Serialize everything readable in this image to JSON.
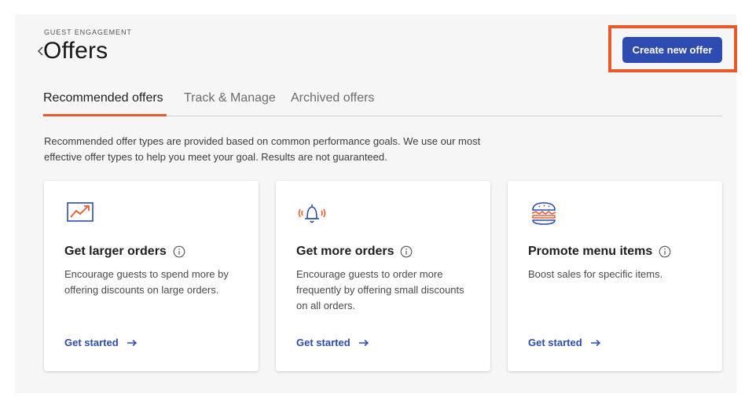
{
  "header": {
    "eyebrow": "GUEST ENGAGEMENT",
    "title": "Offers",
    "cta_label": "Create new offer"
  },
  "tabs": [
    {
      "label": "Recommended offers",
      "active": true
    },
    {
      "label": "Track & Manage",
      "active": false
    },
    {
      "label": "Archived offers",
      "active": false
    }
  ],
  "description": "Recommended offer types are provided based on common performance goals. We use our most effective offer types to help you meet your goal. Results are not guaranteed.",
  "cards": [
    {
      "icon": "trending-up-chart-icon",
      "title": "Get larger orders",
      "text": "Encourage guests to spend more by offering discounts on large orders.",
      "link": "Get started"
    },
    {
      "icon": "ringing-bell-icon",
      "title": "Get more orders",
      "text": "Encourage guests to order more frequently by offering small discounts on all orders.",
      "link": "Get started"
    },
    {
      "icon": "burger-icon",
      "title": "Promote menu items",
      "text": "Boost sales for specific items.",
      "link": "Get started"
    }
  ],
  "colors": {
    "accent": "#e8592b",
    "primary": "#2e4bb1",
    "panel_bg": "#f6f6f6"
  }
}
